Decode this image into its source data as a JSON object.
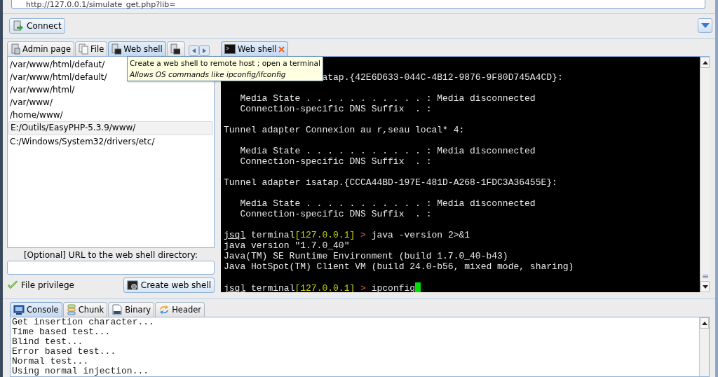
{
  "address_bar": {
    "value": "http://127.0.0.1/simulate_get.php?lib="
  },
  "toolbar": {
    "connect_button": "Connect"
  },
  "left_tabs": [
    {
      "label": "Admin page",
      "selected": false
    },
    {
      "label": "File",
      "selected": false
    },
    {
      "label": "Web shell",
      "selected": true
    },
    {
      "selected": false
    }
  ],
  "tooltip": {
    "line1": "Create a web shell to remote host ; open a terminal",
    "line2": "Allows OS commands like ipconfig/ifconfig"
  },
  "directories": [
    {
      "path": "/var/www/html/defaut/",
      "selected": false
    },
    {
      "path": "/var/www/html/default/",
      "selected": false
    },
    {
      "path": "/var/www/html/",
      "selected": false
    },
    {
      "path": "/var/www/",
      "selected": false
    },
    {
      "path": "/home/www/",
      "selected": false
    },
    {
      "path": "E:/Outils/EasyPHP-5.3.9/www/",
      "selected": true
    },
    {
      "path": "C:/Windows/System32/drivers/etc/",
      "selected": false
    }
  ],
  "url_label": "[Optional] URL to the web shell directory:",
  "file_privilege": {
    "label": "File privilege",
    "checked": true
  },
  "create_button": "Create web shell",
  "right_tab": {
    "label": "Web shell",
    "selected": true
  },
  "terminal_lines": [
    {
      "kind": "covered",
      "text": "atap.{42E6D633-044C-4B12-9876-9F80D745A4CD}:"
    },
    {
      "kind": "blank"
    },
    {
      "kind": "text",
      "text": "   Media State . . . . . . . . . . . : Media disconnected"
    },
    {
      "kind": "text",
      "text": "   Connection-specific DNS Suffix  . :"
    },
    {
      "kind": "blank"
    },
    {
      "kind": "text",
      "text": "Tunnel adapter Connexion au r,seau local* 4:"
    },
    {
      "kind": "blank"
    },
    {
      "kind": "text",
      "text": "   Media State . . . . . . . . . . . : Media disconnected"
    },
    {
      "kind": "text",
      "text": "   Connection-specific DNS Suffix  . :"
    },
    {
      "kind": "blank"
    },
    {
      "kind": "text",
      "text": "Tunnel adapter isatap.{CCCA44BD-197E-481D-A268-1FDC3A36455E}:"
    },
    {
      "kind": "blank"
    },
    {
      "kind": "text",
      "text": "   Media State . . . . . . . . . . . : Media disconnected"
    },
    {
      "kind": "text",
      "text": "   Connection-specific DNS Suffix  . :"
    },
    {
      "kind": "blank"
    },
    {
      "kind": "prompt",
      "user": "jsql",
      "word": "terminal",
      "host": "[127.0.0.1]",
      "sign": ">",
      "command": "java -version 2>&1",
      "cursor": false
    },
    {
      "kind": "text",
      "text": "java version \"1.7.0_40\""
    },
    {
      "kind": "text",
      "text": "Java(TM) SE Runtime Environment (build 1.7.0_40-b43)"
    },
    {
      "kind": "text",
      "text": "Java HotSpot(TM) Client VM (build 24.0-b56, mixed mode, sharing)"
    },
    {
      "kind": "blank"
    },
    {
      "kind": "prompt",
      "user": "jsql",
      "word": "terminal",
      "host": "[127.0.0.1]",
      "sign": ">",
      "command": "ipconfig",
      "cursor": true
    }
  ],
  "bottom_tabs": [
    {
      "label": "Console",
      "selected": true
    },
    {
      "label": "Chunk",
      "selected": false
    },
    {
      "label": "Binary",
      "selected": false
    },
    {
      "label": "Header",
      "selected": false
    }
  ],
  "console_lines": [
    "Get insertion character...",
    "Time based test...",
    "Blind test...",
    "Error based test...",
    "Normal test...",
    "Using normal injection..."
  ]
}
